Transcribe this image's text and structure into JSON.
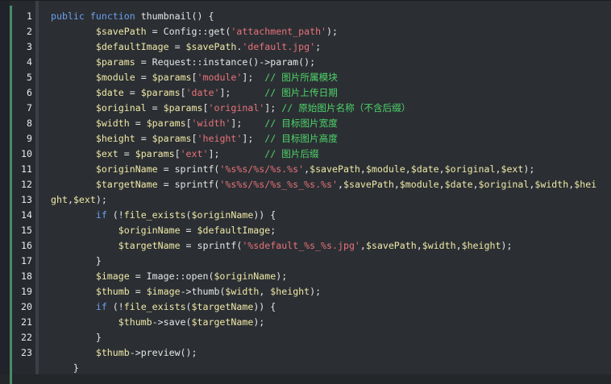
{
  "colors": {
    "background": "#2b2f33",
    "keyword": "#6c9ff0",
    "variable": "#f0e8a8",
    "string": "#e8727a",
    "comment": "#4fd36a",
    "plain": "#e6e6e6"
  },
  "editor": {
    "rows": [
      {
        "n": "1",
        "indent": 0,
        "tokens": [
          [
            "kw",
            "public "
          ],
          [
            "kw",
            "function "
          ],
          [
            "plain",
            "thumbnail() {"
          ]
        ]
      },
      {
        "n": "2",
        "indent": 8,
        "tokens": [
          [
            "var",
            "$savePath"
          ],
          [
            "plain",
            " = Config::get("
          ],
          [
            "str",
            "'attachment_path'"
          ],
          [
            "plain",
            ");"
          ]
        ]
      },
      {
        "n": "3",
        "indent": 8,
        "tokens": [
          [
            "var",
            "$defaultImage"
          ],
          [
            "plain",
            " = "
          ],
          [
            "var",
            "$savePath"
          ],
          [
            "plain",
            "."
          ],
          [
            "str",
            "'default.jpg'"
          ],
          [
            "plain",
            ";"
          ]
        ]
      },
      {
        "n": "4",
        "indent": 8,
        "tokens": [
          [
            "var",
            "$params"
          ],
          [
            "plain",
            " = Request::instance()->param();"
          ]
        ]
      },
      {
        "n": "5",
        "indent": 8,
        "tokens": [
          [
            "var",
            "$module"
          ],
          [
            "plain",
            " = "
          ],
          [
            "var",
            "$params"
          ],
          [
            "plain",
            "["
          ],
          [
            "str",
            "'module'"
          ],
          [
            "plain",
            "];  "
          ],
          [
            "cmt",
            "// 图片所属模块"
          ]
        ]
      },
      {
        "n": "6",
        "indent": 8,
        "tokens": [
          [
            "var",
            "$date"
          ],
          [
            "plain",
            " = "
          ],
          [
            "var",
            "$params"
          ],
          [
            "plain",
            "["
          ],
          [
            "str",
            "'date'"
          ],
          [
            "plain",
            "];      "
          ],
          [
            "cmt",
            "// 图片上传日期"
          ]
        ]
      },
      {
        "n": "7",
        "indent": 8,
        "tokens": [
          [
            "var",
            "$original"
          ],
          [
            "plain",
            " = "
          ],
          [
            "var",
            "$params"
          ],
          [
            "plain",
            "["
          ],
          [
            "str",
            "'original'"
          ],
          [
            "plain",
            "]; "
          ],
          [
            "cmt",
            "// 原始图片名称（不含后缀）"
          ]
        ]
      },
      {
        "n": "8",
        "indent": 8,
        "tokens": [
          [
            "var",
            "$width"
          ],
          [
            "plain",
            " = "
          ],
          [
            "var",
            "$params"
          ],
          [
            "plain",
            "["
          ],
          [
            "str",
            "'width'"
          ],
          [
            "plain",
            "];    "
          ],
          [
            "cmt",
            "// 目标图片宽度"
          ]
        ]
      },
      {
        "n": "9",
        "indent": 8,
        "tokens": [
          [
            "var",
            "$height"
          ],
          [
            "plain",
            " = "
          ],
          [
            "var",
            "$params"
          ],
          [
            "plain",
            "["
          ],
          [
            "str",
            "'height'"
          ],
          [
            "plain",
            "];  "
          ],
          [
            "cmt",
            "// 目标图片高度"
          ]
        ]
      },
      {
        "n": "10",
        "indent": 8,
        "tokens": [
          [
            "var",
            "$ext"
          ],
          [
            "plain",
            " = "
          ],
          [
            "var",
            "$params"
          ],
          [
            "plain",
            "["
          ],
          [
            "str",
            "'ext'"
          ],
          [
            "plain",
            "];        "
          ],
          [
            "cmt",
            "// 图片后缀"
          ]
        ]
      },
      {
        "n": "11",
        "indent": 8,
        "tokens": [
          [
            "var",
            "$originName"
          ],
          [
            "plain",
            " = sprintf("
          ],
          [
            "str",
            "'%s%s/%s/%s.%s'"
          ],
          [
            "plain",
            ","
          ],
          [
            "var",
            "$savePath"
          ],
          [
            "plain",
            ","
          ],
          [
            "var",
            "$module"
          ],
          [
            "plain",
            ","
          ],
          [
            "var",
            "$date"
          ],
          [
            "plain",
            ","
          ],
          [
            "var",
            "$original"
          ],
          [
            "plain",
            ","
          ],
          [
            "var",
            "$ext"
          ],
          [
            "plain",
            ");"
          ]
        ]
      },
      {
        "n": "12",
        "indent": 8,
        "tokens": [
          [
            "var",
            "$targetName"
          ],
          [
            "plain",
            " = sprintf("
          ],
          [
            "str",
            "'%s%s/%s/%s_%s_%s.%s'"
          ],
          [
            "plain",
            ","
          ],
          [
            "var",
            "$savePath"
          ],
          [
            "plain",
            ","
          ],
          [
            "var",
            "$module"
          ],
          [
            "plain",
            ","
          ],
          [
            "var",
            "$date"
          ],
          [
            "plain",
            ","
          ],
          [
            "var",
            "$original"
          ],
          [
            "plain",
            ","
          ],
          [
            "var",
            "$width"
          ],
          [
            "plain",
            ","
          ],
          [
            "var",
            "$hei"
          ]
        ]
      },
      {
        "n": "13",
        "indent": 0,
        "tokens": [
          [
            "var",
            "ght"
          ],
          [
            "plain",
            ","
          ],
          [
            "var",
            "$ext"
          ],
          [
            "plain",
            ");"
          ]
        ]
      },
      {
        "n": "14",
        "indent": 8,
        "tokens": [
          [
            "kw",
            "if"
          ],
          [
            "plain",
            " (!"
          ],
          [
            "var",
            "file_exists"
          ],
          [
            "plain",
            "("
          ],
          [
            "var",
            "$originName"
          ],
          [
            "plain",
            ")) {"
          ]
        ]
      },
      {
        "n": "15",
        "indent": 12,
        "tokens": [
          [
            "var",
            "$originName"
          ],
          [
            "plain",
            " = "
          ],
          [
            "var",
            "$defaultImage"
          ],
          [
            "plain",
            ";"
          ]
        ]
      },
      {
        "n": "16",
        "indent": 12,
        "tokens": [
          [
            "var",
            "$targetName"
          ],
          [
            "plain",
            " = sprintf("
          ],
          [
            "str",
            "'%sdefault_%s_%s.jpg'"
          ],
          [
            "plain",
            ","
          ],
          [
            "var",
            "$savePath"
          ],
          [
            "plain",
            ","
          ],
          [
            "var",
            "$width"
          ],
          [
            "plain",
            ","
          ],
          [
            "var",
            "$height"
          ],
          [
            "plain",
            ");"
          ]
        ]
      },
      {
        "n": "17",
        "indent": 8,
        "tokens": [
          [
            "plain",
            "}"
          ]
        ]
      },
      {
        "n": "18",
        "indent": 8,
        "tokens": [
          [
            "var",
            "$image"
          ],
          [
            "plain",
            " = Image::open("
          ],
          [
            "var",
            "$originName"
          ],
          [
            "plain",
            ");"
          ]
        ]
      },
      {
        "n": "19",
        "indent": 8,
        "tokens": [
          [
            "var",
            "$thumb"
          ],
          [
            "plain",
            " = "
          ],
          [
            "var",
            "$image"
          ],
          [
            "plain",
            "->thumb("
          ],
          [
            "var",
            "$width"
          ],
          [
            "plain",
            ", "
          ],
          [
            "var",
            "$height"
          ],
          [
            "plain",
            ");"
          ]
        ]
      },
      {
        "n": "20",
        "indent": 8,
        "tokens": [
          [
            "kw",
            "if"
          ],
          [
            "plain",
            " (!"
          ],
          [
            "var",
            "file_exists"
          ],
          [
            "plain",
            "("
          ],
          [
            "var",
            "$targetName"
          ],
          [
            "plain",
            ")) {"
          ]
        ]
      },
      {
        "n": "21",
        "indent": 12,
        "tokens": [
          [
            "var",
            "$thumb"
          ],
          [
            "plain",
            "->save("
          ],
          [
            "var",
            "$targetName"
          ],
          [
            "plain",
            ");"
          ]
        ]
      },
      {
        "n": "22",
        "indent": 8,
        "tokens": [
          [
            "plain",
            "}"
          ]
        ]
      },
      {
        "n": "23",
        "indent": 8,
        "tokens": [
          [
            "var",
            "$thumb"
          ],
          [
            "plain",
            "->preview();"
          ]
        ]
      },
      {
        "n": "",
        "indent": 4,
        "tokens": [
          [
            "plain",
            "}"
          ]
        ]
      }
    ]
  }
}
